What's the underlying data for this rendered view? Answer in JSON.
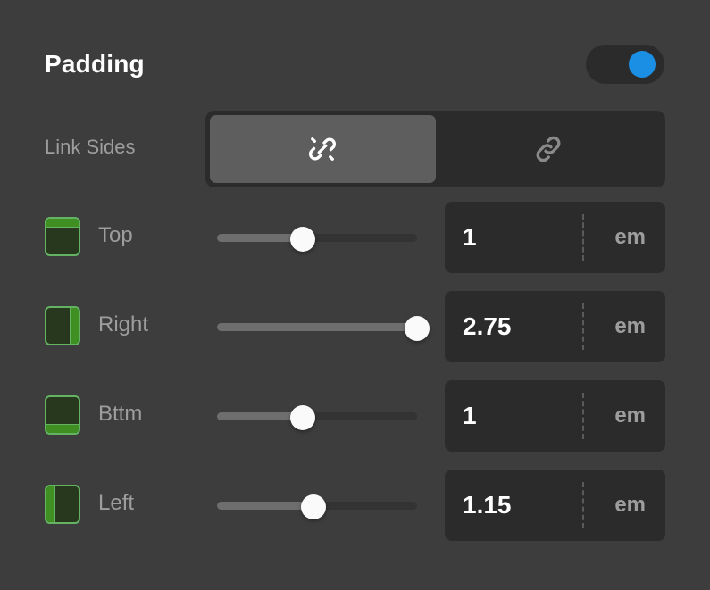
{
  "header": {
    "title": "Padding",
    "toggle": {
      "name": "padding-enabled-toggle",
      "state": "on",
      "accent_color": "#1a8fe3"
    }
  },
  "link_sides": {
    "label": "Link Sides",
    "selected_index": 0,
    "options": [
      {
        "icon": "unlink-icon",
        "selected": true
      },
      {
        "icon": "link-icon",
        "selected": false
      }
    ]
  },
  "colors": {
    "panel_bg": "#3d3d3d",
    "field_bg": "#2b2b2b",
    "segment_active_bg": "#5e5e5e",
    "label_text": "#9d9d9d",
    "value_text": "#ffffff",
    "slider_fill": "#6e6e6e",
    "slider_track": "#333333",
    "slider_thumb": "#fafafa",
    "icon_outline_green": "#63b363",
    "icon_fill_green": "#3f8f22",
    "icon_body_green": "#28381f",
    "accent_blue": "#1a8fe3"
  },
  "sides": [
    {
      "key": "top",
      "label": "Top",
      "icon": "padding-top-icon",
      "edge": "top",
      "slider_percent": 43,
      "value": "1",
      "unit": "em"
    },
    {
      "key": "right",
      "label": "Right",
      "icon": "padding-right-icon",
      "edge": "right",
      "slider_percent": 100,
      "value": "2.75",
      "unit": "em"
    },
    {
      "key": "bottom",
      "label": "Bttm",
      "icon": "padding-bottom-icon",
      "edge": "bottom",
      "slider_percent": 43,
      "value": "1",
      "unit": "em"
    },
    {
      "key": "left",
      "label": "Left",
      "icon": "padding-left-icon",
      "edge": "left",
      "slider_percent": 48,
      "value": "1.15",
      "unit": "em"
    }
  ]
}
